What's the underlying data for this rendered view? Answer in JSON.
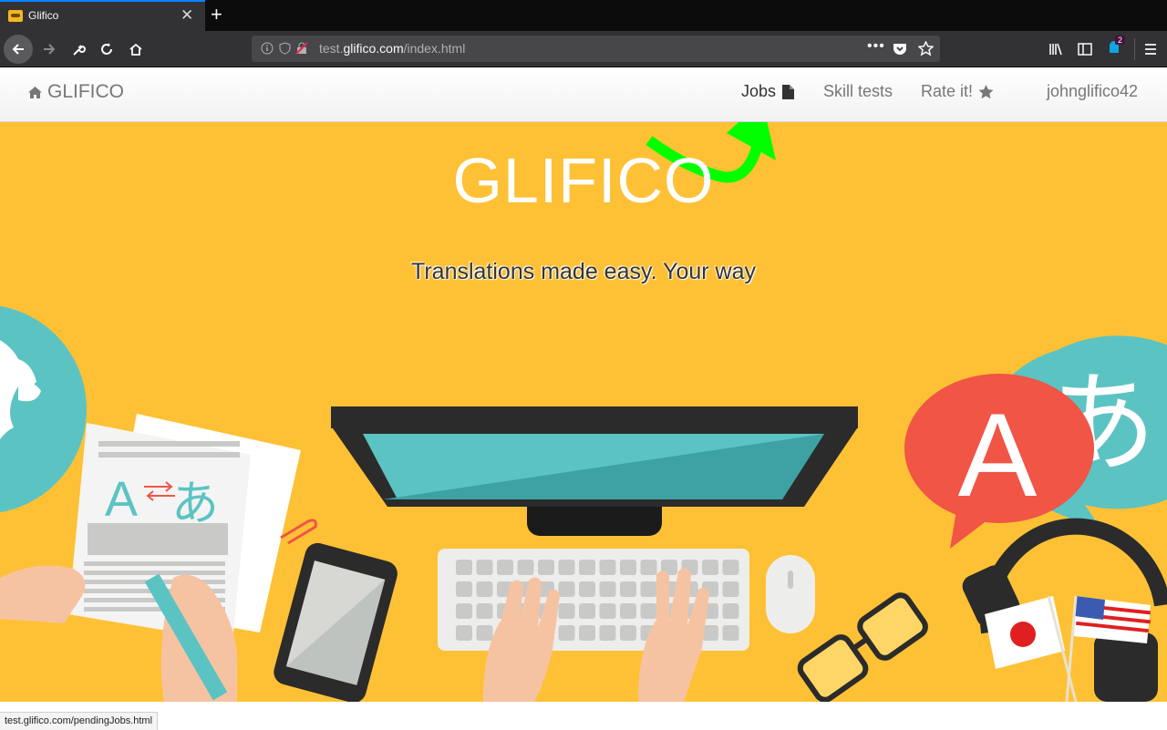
{
  "browser": {
    "tab_title": "Glifico",
    "url_host_prefix": "test.",
    "url_host_domain": "glifico.com",
    "url_path": "/index.html",
    "notification_count": "2",
    "status_url": "test.glifico.com/pendingJobs.html"
  },
  "site": {
    "brand": "GLIFICO",
    "nav": {
      "jobs": "Jobs",
      "skill_tests": "Skill tests",
      "rate_it": "Rate it!",
      "user": "johnglifico42"
    },
    "hero": {
      "title": "GLIFICO",
      "subtitle": "Translations made easy. Your way",
      "illustration_letters": {
        "latin": "A",
        "kana": "あ"
      }
    }
  },
  "colors": {
    "hero_bg": "#fec135",
    "accent_arrow": "#00ff00",
    "bubble_red": "#f05545",
    "bubble_teal": "#5cc3c3"
  }
}
